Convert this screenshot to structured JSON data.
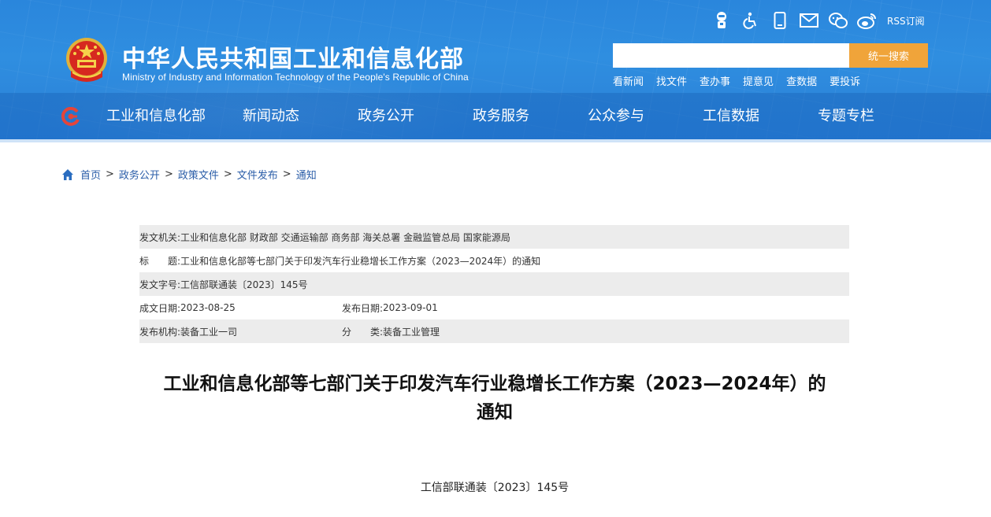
{
  "header": {
    "title": "中华人民共和国工业和信息化部",
    "subtitle": "Ministry of Industry and Information Technology of the People's Republic of China",
    "top_icons": [
      "robot-icon",
      "accessibility-icon",
      "mobile-icon",
      "mail-icon",
      "wechat-icon",
      "weibo-icon"
    ],
    "rss_label": "RSS订阅",
    "search": {
      "placeholder": "",
      "button_label": "统一搜索"
    },
    "quick_links": [
      "看新闻",
      "找文件",
      "查办事",
      "提意见",
      "查数据",
      "要投诉"
    ],
    "nav": [
      "工业和信息化部",
      "新闻动态",
      "政务公开",
      "政务服务",
      "公众参与",
      "工信数据",
      "专题专栏"
    ],
    "accent_color": "#f0a43a",
    "header_color": "#2f8ee0"
  },
  "breadcrumb": [
    "首页",
    "政务公开",
    "政策文件",
    "文件发布",
    "通知"
  ],
  "info": {
    "issuer_label": "发文机关:",
    "issuer_value": "工业和信息化部 财政部 交通运输部 商务部 海关总署 金融监管总局 国家能源局",
    "title_label": "标　　题:",
    "title_value": "工业和信息化部等七部门关于印发汽车行业稳增长工作方案（2023—2024年）的通知",
    "docno_label": "发文字号:",
    "docno_value": "工信部联通装〔2023〕145号",
    "created_label": "成文日期:",
    "created_value": "2023-08-25",
    "published_label": "发布日期:",
    "published_value": "2023-09-01",
    "org_label": "发布机构:",
    "org_value": "装备工业一司",
    "category_label": "分　　类:",
    "category_value": "装备工业管理"
  },
  "article": {
    "title_line1": "工业和信息化部等七部门关于印发汽车行业稳增长工作方案（2023—2024年）的",
    "title_line2": "通知",
    "doc_number": "工信部联通装〔2023〕145号"
  }
}
